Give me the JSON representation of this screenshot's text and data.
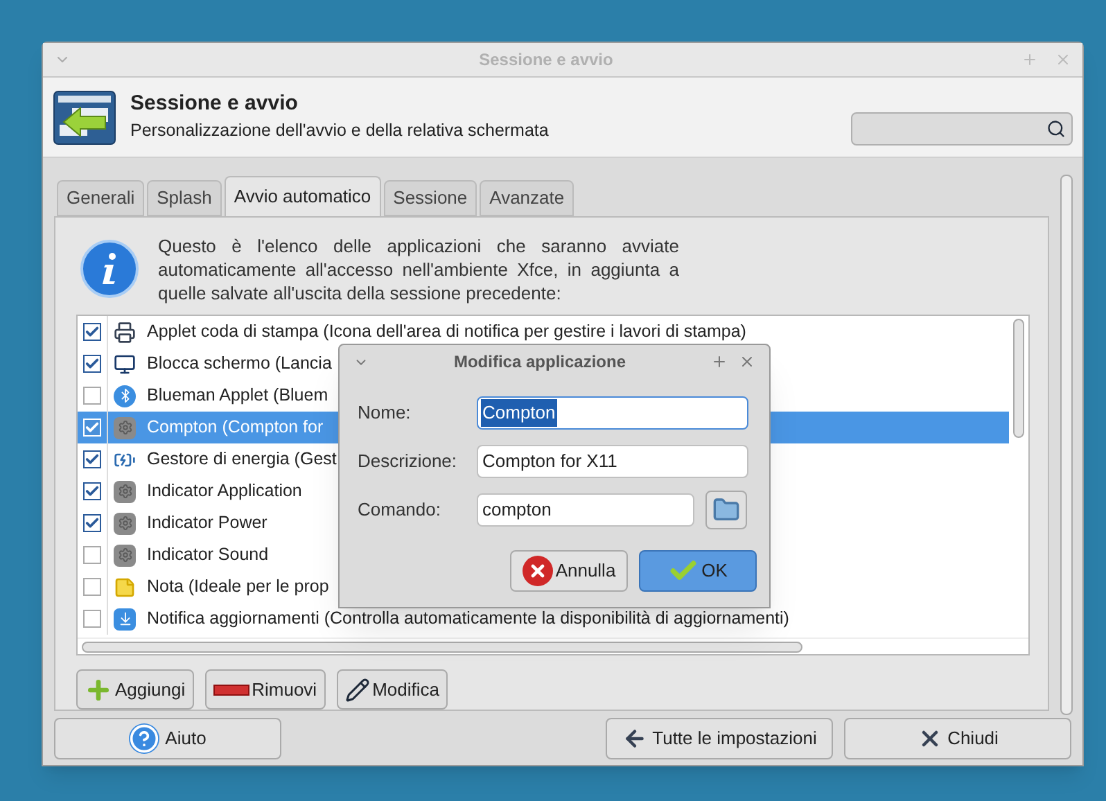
{
  "window": {
    "title": "Sessione e avvio"
  },
  "header": {
    "title": "Sessione e avvio",
    "subtitle": "Personalizzazione dell'avvio e della relativa schermata"
  },
  "tabs": [
    {
      "label": "Generali",
      "selected": false
    },
    {
      "label": "Splash",
      "selected": false
    },
    {
      "label": "Avvio automatico",
      "selected": true
    },
    {
      "label": "Sessione",
      "selected": false
    },
    {
      "label": "Avanzate",
      "selected": false
    }
  ],
  "info_text": "Questo è l'elenco delle applicazioni che saranno avviate automaticamente all'accesso nell'ambiente Xfce, in aggiunta a quelle salvate all'uscita della sessione precedente:",
  "apps": [
    {
      "label": "Applet coda di stampa (Icona dell'area di notifica per gestire i lavori di stampa)",
      "checked": true,
      "selected": false,
      "kind": "printer"
    },
    {
      "label": "Blocca schermo (Lancia",
      "checked": true,
      "selected": false,
      "kind": "monitor"
    },
    {
      "label": "Blueman Applet (Bluem",
      "checked": false,
      "selected": false,
      "kind": "bluetooth"
    },
    {
      "label": "Compton (Compton for",
      "checked": true,
      "selected": true,
      "kind": "gear"
    },
    {
      "label": "Gestore di energia (Gest",
      "checked": true,
      "selected": false,
      "kind": "battery"
    },
    {
      "label": "Indicator Application",
      "checked": true,
      "selected": false,
      "kind": "gear"
    },
    {
      "label": "Indicator Power",
      "checked": true,
      "selected": false,
      "kind": "gear"
    },
    {
      "label": "Indicator Sound",
      "checked": false,
      "selected": false,
      "kind": "gear"
    },
    {
      "label": "Nota (Ideale per le prop",
      "checked": false,
      "selected": false,
      "kind": "note"
    },
    {
      "label": "Notifica aggiornamenti (Controlla automaticamente la disponibilità di aggiornamenti)",
      "checked": false,
      "selected": false,
      "kind": "update"
    }
  ],
  "list_buttons": [
    {
      "label": "Aggiungi",
      "kind": "add"
    },
    {
      "label": "Rimuovi",
      "kind": "remove"
    },
    {
      "label": "Modifica",
      "kind": "edit"
    }
  ],
  "footer_buttons": [
    {
      "label": "Aiuto",
      "kind": "help"
    },
    {
      "label": "Tutte le impostazioni",
      "kind": "back"
    },
    {
      "label": "Chiudi",
      "kind": "close"
    }
  ],
  "dialog": {
    "title": "Modifica applicazione",
    "fields": [
      {
        "label": "Nome:",
        "value": "Compton",
        "focused": true,
        "browse": false
      },
      {
        "label": "Descrizione:",
        "value": "Compton for X11",
        "focused": false,
        "browse": false
      },
      {
        "label": "Comando:",
        "value": "compton",
        "focused": false,
        "browse": true
      }
    ],
    "buttons": [
      {
        "label": "Annulla",
        "kind": "cancel",
        "default": false
      },
      {
        "label": "OK",
        "kind": "ok",
        "default": true
      }
    ]
  }
}
